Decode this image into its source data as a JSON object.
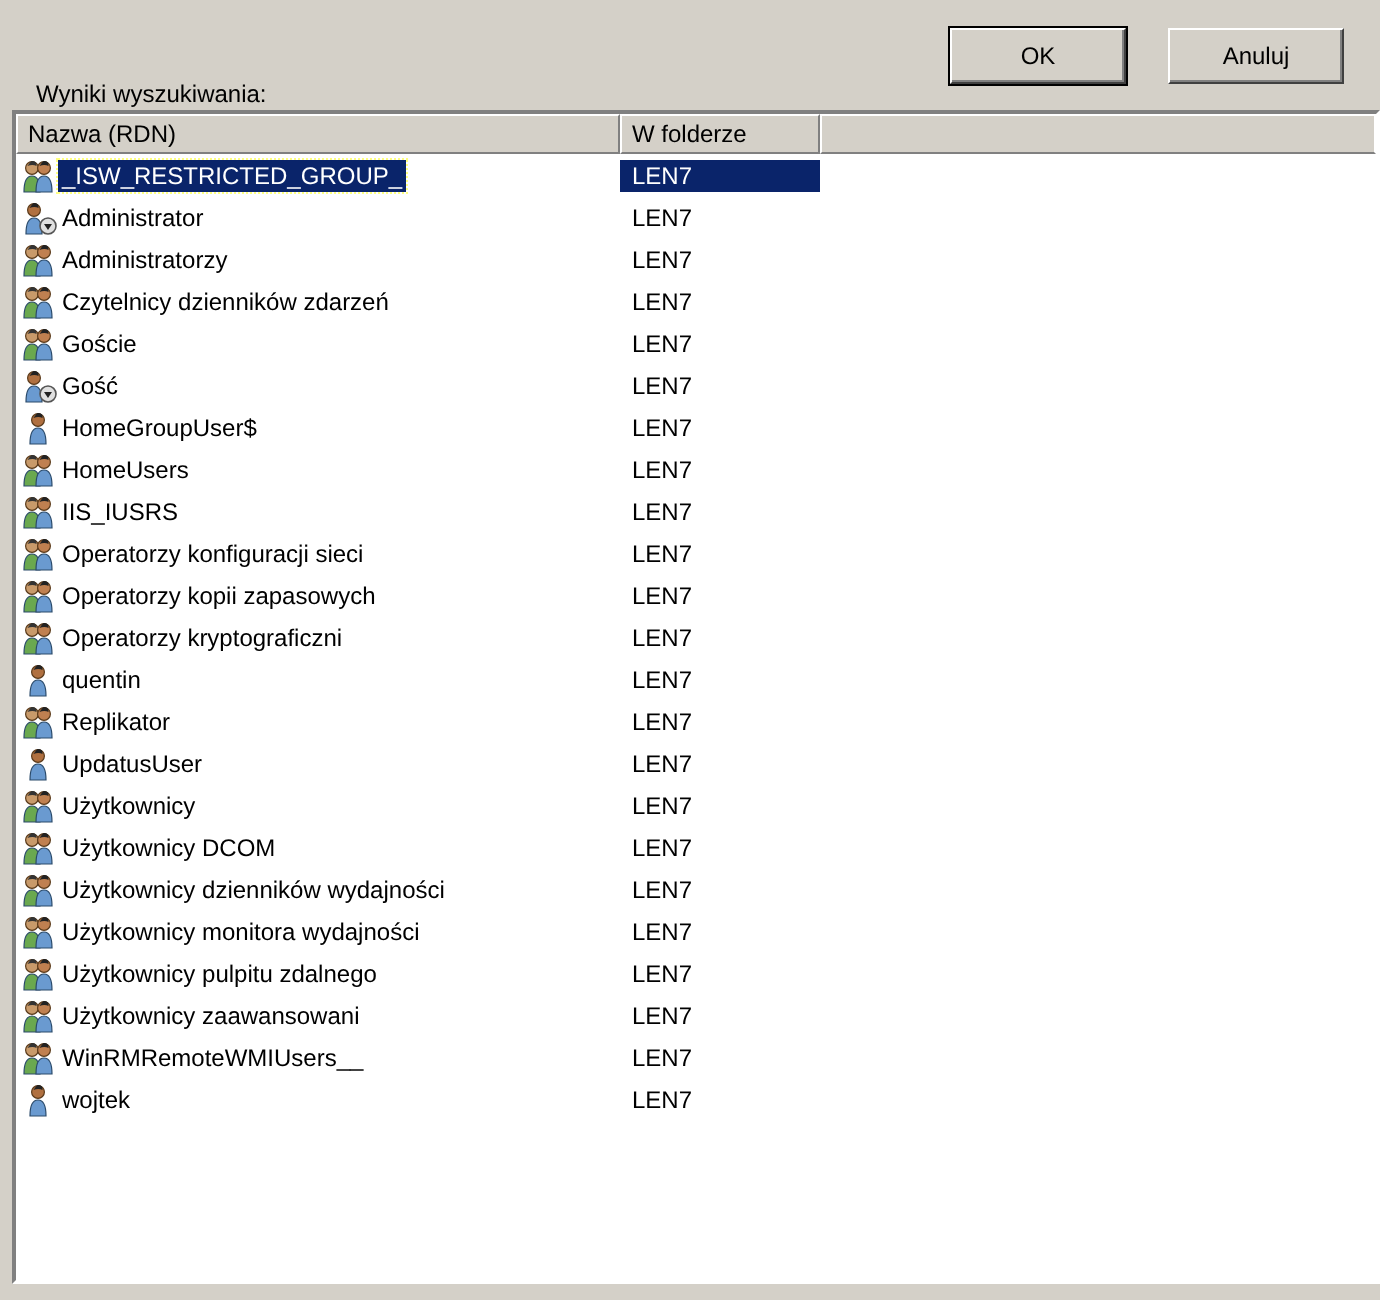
{
  "buttons": [
    {
      "label": "OK",
      "default": true
    },
    {
      "label": "Anuluj",
      "default": false
    }
  ],
  "results_label": "Wyniki wyszukiwania:",
  "table": {
    "columns": [
      "Nazwa (RDN)",
      "W folderze"
    ],
    "rows": [
      {
        "kind": "group",
        "name": "_ISW_RESTRICTED_GROUP_",
        "folder": "LEN7",
        "selected": true
      },
      {
        "kind": "disabled-user",
        "name": "Administrator",
        "folder": "LEN7",
        "selected": false
      },
      {
        "kind": "group",
        "name": "Administratorzy",
        "folder": "LEN7",
        "selected": false
      },
      {
        "kind": "group",
        "name": "Czytelnicy dzienników zdarzeń",
        "folder": "LEN7",
        "selected": false
      },
      {
        "kind": "group",
        "name": "Goście",
        "folder": "LEN7",
        "selected": false
      },
      {
        "kind": "disabled-user",
        "name": "Gość",
        "folder": "LEN7",
        "selected": false
      },
      {
        "kind": "user",
        "name": "HomeGroupUser$",
        "folder": "LEN7",
        "selected": false
      },
      {
        "kind": "group",
        "name": "HomeUsers",
        "folder": "LEN7",
        "selected": false
      },
      {
        "kind": "group",
        "name": "IIS_IUSRS",
        "folder": "LEN7",
        "selected": false
      },
      {
        "kind": "group",
        "name": "Operatorzy konfiguracji sieci",
        "folder": "LEN7",
        "selected": false
      },
      {
        "kind": "group",
        "name": "Operatorzy kopii zapasowych",
        "folder": "LEN7",
        "selected": false
      },
      {
        "kind": "group",
        "name": "Operatorzy kryptograficzni",
        "folder": "LEN7",
        "selected": false
      },
      {
        "kind": "user",
        "name": "quentin",
        "folder": "LEN7",
        "selected": false
      },
      {
        "kind": "group",
        "name": "Replikator",
        "folder": "LEN7",
        "selected": false
      },
      {
        "kind": "user",
        "name": "UpdatusUser",
        "folder": "LEN7",
        "selected": false
      },
      {
        "kind": "group",
        "name": "Użytkownicy",
        "folder": "LEN7",
        "selected": false
      },
      {
        "kind": "group",
        "name": "Użytkownicy DCOM",
        "folder": "LEN7",
        "selected": false
      },
      {
        "kind": "group",
        "name": "Użytkownicy dzienników wydajności",
        "folder": "LEN7",
        "selected": false
      },
      {
        "kind": "group",
        "name": "Użytkownicy monitora wydajności",
        "folder": "LEN7",
        "selected": false
      },
      {
        "kind": "group",
        "name": "Użytkownicy pulpitu zdalnego",
        "folder": "LEN7",
        "selected": false
      },
      {
        "kind": "group",
        "name": "Użytkownicy zaawansowani",
        "folder": "LEN7",
        "selected": false
      },
      {
        "kind": "group",
        "name": "WinRMRemoteWMIUsers__",
        "folder": "LEN7",
        "selected": false
      },
      {
        "kind": "user",
        "name": "wojtek",
        "folder": "LEN7",
        "selected": false
      }
    ]
  }
}
